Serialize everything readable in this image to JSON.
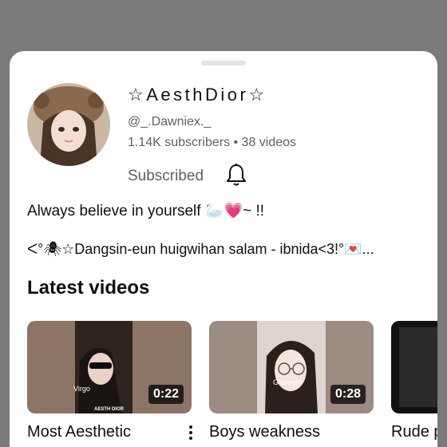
{
  "channel": {
    "name": "☆AesthDior☆",
    "handle": "@_.Dawniex._",
    "stats": "1.14K subscribers • 38 videos",
    "subscribe_state": "Subscribed",
    "description_line1": "Always believe in yourself 🦢💗~ !!",
    "description_line2": "ᐸ°🕷☆Dangsin-eun huigwihan salam - ibnida<3!°💌..."
  },
  "section": {
    "title": "Latest videos"
  },
  "videos": [
    {
      "title": "Most Aesthetic",
      "duration": "0:22",
      "overlay_label": "Virgo",
      "watermark": "AESTH DIOR"
    },
    {
      "title": "Boys weakness",
      "duration": "0:28",
      "overlay_label": "Glasses>"
    },
    {
      "title": "Rude p"
    }
  ],
  "colors": {
    "overlay": "#7a7a7a",
    "sheet": "#ffffff",
    "secondary_text": "#606060",
    "primary_text": "#0f0f0f"
  },
  "icons": {
    "bell": "notification-bell-icon",
    "more": "more-vert-icon"
  }
}
